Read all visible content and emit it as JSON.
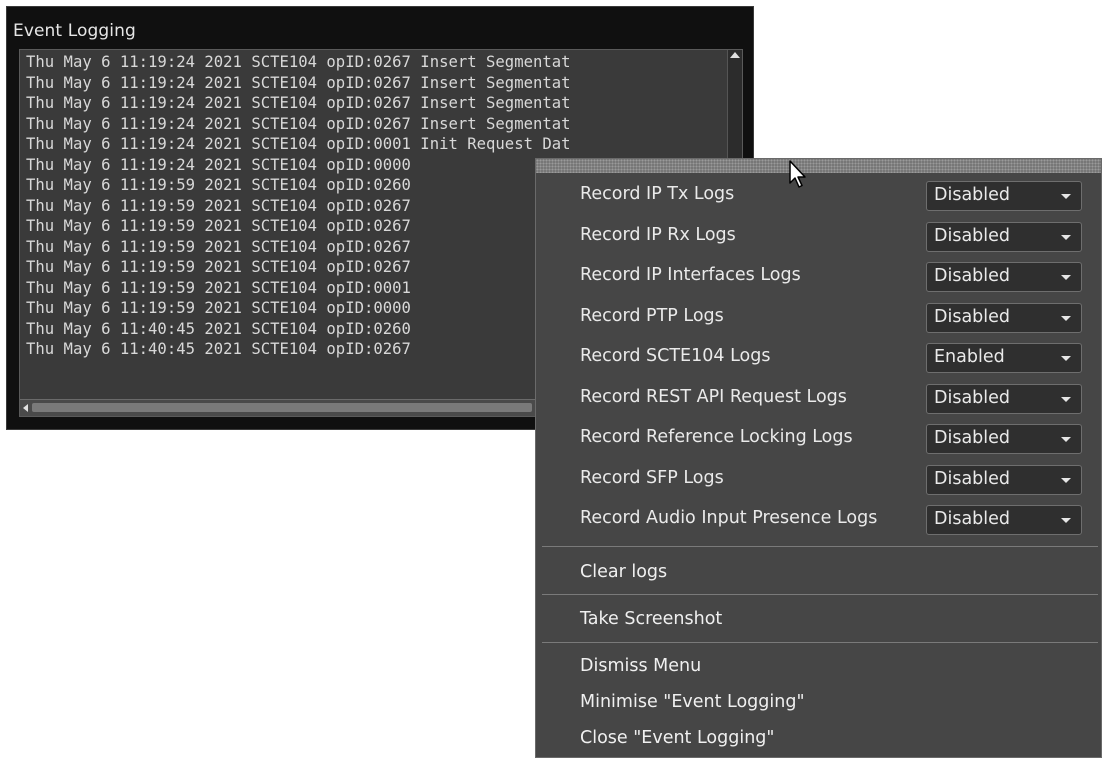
{
  "window": {
    "title": "Event Logging",
    "log_lines": [
      "Thu May 6 11:19:24 2021 SCTE104 opID:0267 Insert Segmentat",
      "Thu May 6 11:19:24 2021 SCTE104 opID:0267 Insert Segmentat",
      "Thu May 6 11:19:24 2021 SCTE104 opID:0267 Insert Segmentat",
      "Thu May 6 11:19:24 2021 SCTE104 opID:0267 Insert Segmentat",
      "Thu May 6 11:19:24 2021 SCTE104 opID:0001 Init Request Dat",
      "Thu May 6 11:19:24 2021 SCTE104 opID:0000",
      "Thu May 6 11:19:59 2021 SCTE104 opID:0260",
      "Thu May 6 11:19:59 2021 SCTE104 opID:0267",
      "Thu May 6 11:19:59 2021 SCTE104 opID:0267",
      "Thu May 6 11:19:59 2021 SCTE104 opID:0267",
      "Thu May 6 11:19:59 2021 SCTE104 opID:0267",
      "Thu May 6 11:19:59 2021 SCTE104 opID:0001",
      "Thu May 6 11:19:59 2021 SCTE104 opID:0000",
      "Thu May 6 11:40:45 2021 SCTE104 opID:0260",
      "Thu May 6 11:40:45 2021 SCTE104 opID:0267"
    ]
  },
  "menu": {
    "settings": [
      {
        "label": "Record IP Tx Logs",
        "value": "Disabled"
      },
      {
        "label": "Record IP Rx Logs",
        "value": "Disabled"
      },
      {
        "label": "Record IP Interfaces Logs",
        "value": "Disabled"
      },
      {
        "label": "Record PTP Logs",
        "value": "Disabled"
      },
      {
        "label": "Record SCTE104 Logs",
        "value": "Enabled"
      },
      {
        "label": "Record REST API Request Logs",
        "value": "Disabled"
      },
      {
        "label": "Record Reference Locking Logs",
        "value": "Disabled"
      },
      {
        "label": "Record SFP Logs",
        "value": "Disabled"
      },
      {
        "label": "Record Audio Input Presence Logs",
        "value": "Disabled"
      }
    ],
    "clear_logs": "Clear logs",
    "take_screenshot": "Take Screenshot",
    "dismiss_menu": "Dismiss Menu",
    "minimise": "Minimise \"Event Logging\"",
    "close": "Close \"Event Logging\""
  },
  "icons": {
    "cursor": "mouse-pointer-icon",
    "dropdown": "chevron-down-icon",
    "scroll_up": "scroll-up-arrow-icon",
    "scroll_left": "scroll-left-arrow-icon"
  }
}
